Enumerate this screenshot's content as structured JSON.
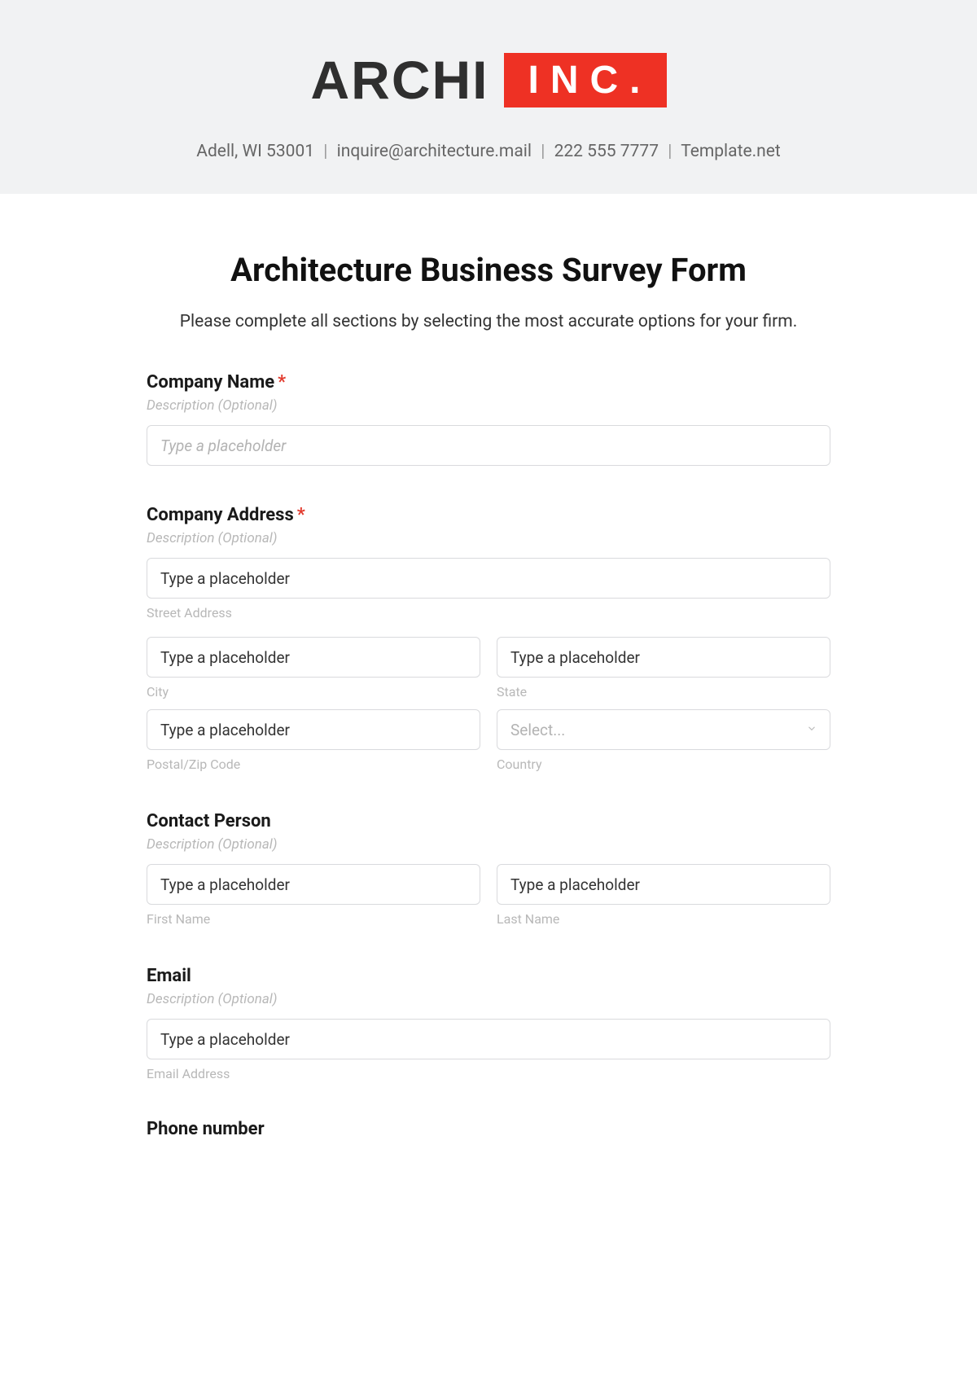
{
  "header": {
    "logo_left": "ARCHI",
    "logo_right": "INC.",
    "contact_location": "Adell, WI 53001",
    "contact_email": "inquire@architecture.mail",
    "contact_phone": "222 555 7777",
    "contact_site": "Template.net",
    "separator": "|"
  },
  "form": {
    "title": "Architecture Business Survey Form",
    "subtitle": "Please complete all sections by selecting the most accurate options for your firm.",
    "required_mark": "*",
    "company_name": {
      "label": "Company Name",
      "required": true,
      "description": "Description (Optional)",
      "placeholder": "Type a placeholder"
    },
    "company_address": {
      "label": "Company Address",
      "required": true,
      "description": "Description (Optional)",
      "street": {
        "placeholder": "Type a placeholder",
        "sublabel": "Street Address"
      },
      "city": {
        "placeholder": "Type a placeholder",
        "sublabel": "City"
      },
      "state": {
        "placeholder": "Type a placeholder",
        "sublabel": "State"
      },
      "postal": {
        "placeholder": "Type a placeholder",
        "sublabel": "Postal/Zip Code"
      },
      "country": {
        "placeholder": "Select...",
        "sublabel": "Country"
      }
    },
    "contact_person": {
      "label": "Contact Person",
      "description": "Description (Optional)",
      "first": {
        "placeholder": "Type a placeholder",
        "sublabel": "First Name"
      },
      "last": {
        "placeholder": "Type a placeholder",
        "sublabel": "Last Name"
      }
    },
    "email": {
      "label": "Email",
      "description": "Description (Optional)",
      "placeholder": "Type a placeholder",
      "sublabel": "Email Address"
    },
    "phone": {
      "label": "Phone number"
    }
  }
}
